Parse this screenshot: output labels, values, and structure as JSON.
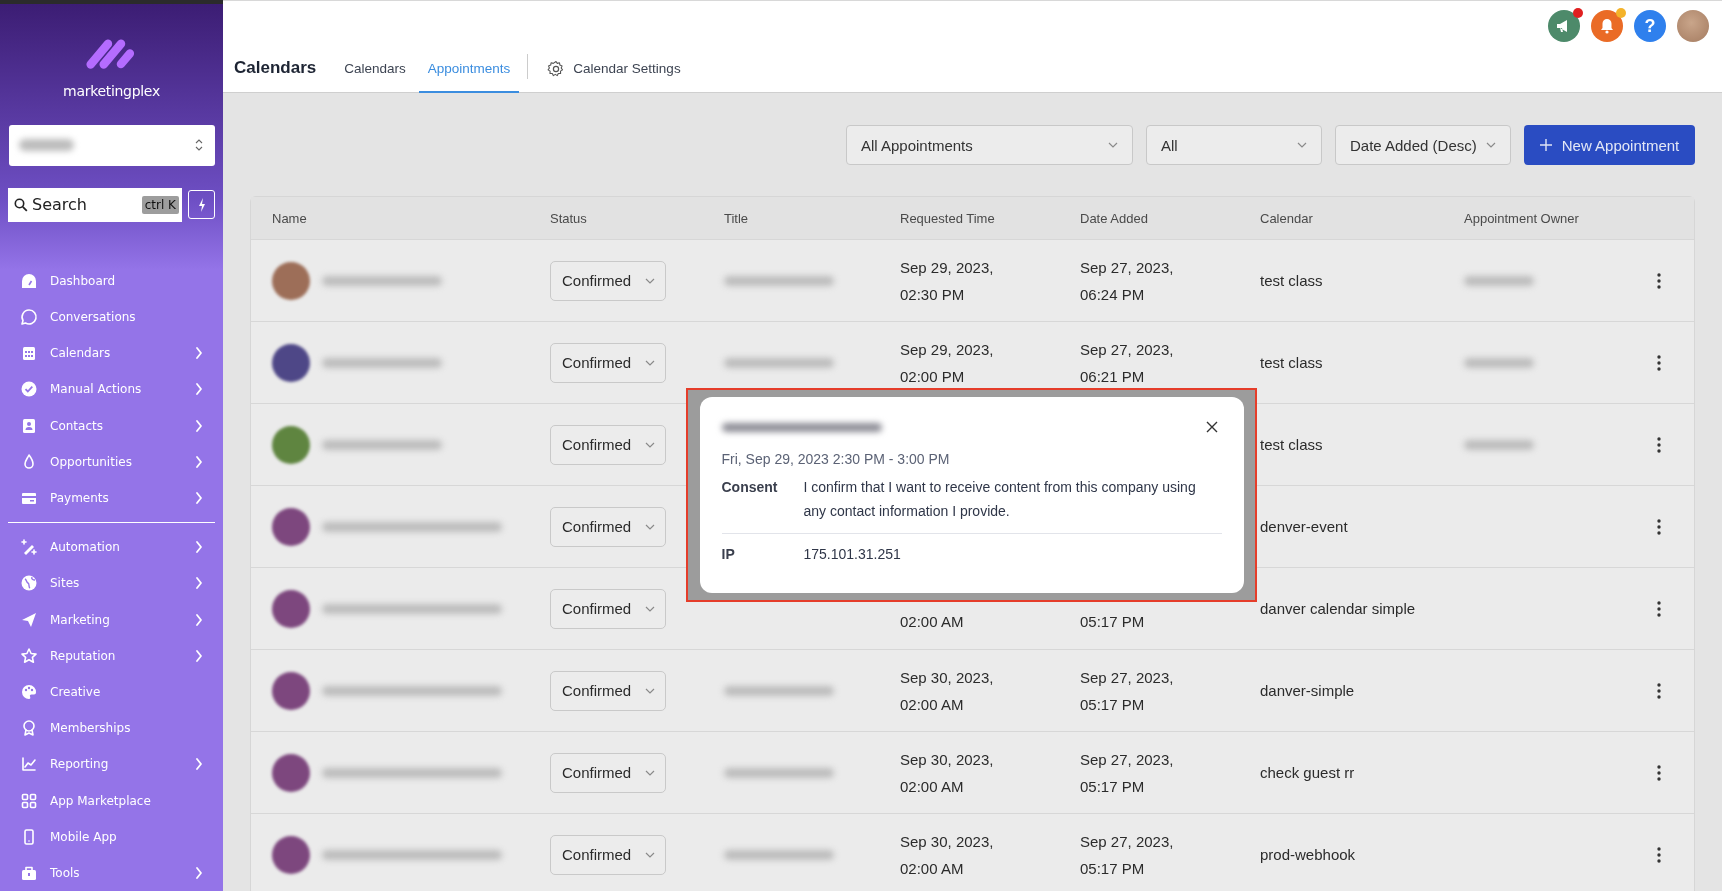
{
  "sidebar": {
    "brand": "marketingplex",
    "search": {
      "placeholder": "Search",
      "shortcut": "ctrl K"
    },
    "sections": [
      [
        {
          "label": "Dashboard",
          "expandable": false
        },
        {
          "label": "Conversations",
          "expandable": false
        },
        {
          "label": "Calendars",
          "expandable": true
        },
        {
          "label": "Manual Actions",
          "expandable": true
        },
        {
          "label": "Contacts",
          "expandable": true
        },
        {
          "label": "Opportunities",
          "expandable": true
        },
        {
          "label": "Payments",
          "expandable": true
        }
      ],
      [
        {
          "label": "Automation",
          "expandable": true
        },
        {
          "label": "Sites",
          "expandable": true
        },
        {
          "label": "Marketing",
          "expandable": true
        },
        {
          "label": "Reputation",
          "expandable": true
        },
        {
          "label": "Creative",
          "expandable": false
        },
        {
          "label": "Memberships",
          "expandable": false
        },
        {
          "label": "Reporting",
          "expandable": true
        },
        {
          "label": "App Marketplace",
          "expandable": false
        },
        {
          "label": "Mobile App",
          "expandable": false
        },
        {
          "label": "Tools",
          "expandable": true
        }
      ]
    ]
  },
  "header": {
    "title": "Calendars",
    "help": "?",
    "tabs": [
      {
        "label": "Calendars",
        "selected": false
      },
      {
        "label": "Appointments",
        "selected": true
      }
    ],
    "settings": "Calendar Settings"
  },
  "filters": [
    {
      "value": "All Appointments"
    },
    {
      "value": "All"
    },
    {
      "value": "Date Added (Desc)"
    }
  ],
  "new_button": "New Appointment",
  "table": {
    "columns": [
      "Name",
      "Status",
      "Title",
      "Requested Time",
      "Date Added",
      "Calendar",
      "Appointment Owner"
    ],
    "rows": [
      {
        "color": "#9d6e58",
        "status": "Confirmed",
        "has_title": true,
        "requested": [
          "Sep 29, 2023,",
          "02:30 PM"
        ],
        "added": [
          "Sep 27, 2023,",
          "06:24 PM"
        ],
        "calendar": "test class",
        "has_owner": true
      },
      {
        "color": "#4e4787",
        "status": "Confirmed",
        "has_title": true,
        "requested": [
          "Sep 29, 2023,",
          "02:00 PM"
        ],
        "added": [
          "Sep 27, 2023,",
          "06:21 PM"
        ],
        "calendar": "test class",
        "has_owner": true
      },
      {
        "color": "#5f8540",
        "status": "Confirmed",
        "has_title": false,
        "requested": [],
        "added": [],
        "calendar": "test class",
        "has_owner": true
      },
      {
        "color": "#7d477e",
        "status": "Confirmed",
        "has_title": false,
        "requested": [],
        "added": [],
        "calendar": "denver-event",
        "has_owner": false
      },
      {
        "color": "#7d477e",
        "status": "Confirmed",
        "has_title": false,
        "requested": [
          "02:00 AM"
        ],
        "added": [
          "05:17 PM"
        ],
        "calendar": "danver calendar simple",
        "has_owner": false
      },
      {
        "color": "#7d477e",
        "status": "Confirmed",
        "has_title": true,
        "requested": [
          "Sep 30, 2023,",
          "02:00 AM"
        ],
        "added": [
          "Sep 27, 2023,",
          "05:17 PM"
        ],
        "calendar": "danver-simple",
        "has_owner": false
      },
      {
        "color": "#7d477e",
        "status": "Confirmed",
        "has_title": true,
        "requested": [
          "Sep 30, 2023,",
          "02:00 AM"
        ],
        "added": [
          "Sep 27, 2023,",
          "05:17 PM"
        ],
        "calendar": "check guest rr",
        "has_owner": false
      },
      {
        "color": "#7d477e",
        "status": "Confirmed",
        "has_title": true,
        "requested": [
          "Sep 30, 2023,",
          "02:00 AM"
        ],
        "added": [
          "Sep 27, 2023,",
          "05:17 PM"
        ],
        "calendar": "prod-webhook",
        "has_owner": false
      }
    ]
  },
  "modal": {
    "when": "Fri, Sep 29, 2023 2:30 PM - 3:00 PM",
    "details": [
      {
        "label": "Consent",
        "value": "I confirm that I want to receive content from this company using any contact information I provide."
      },
      {
        "label": "IP",
        "value": "175.101.31.251"
      }
    ]
  }
}
